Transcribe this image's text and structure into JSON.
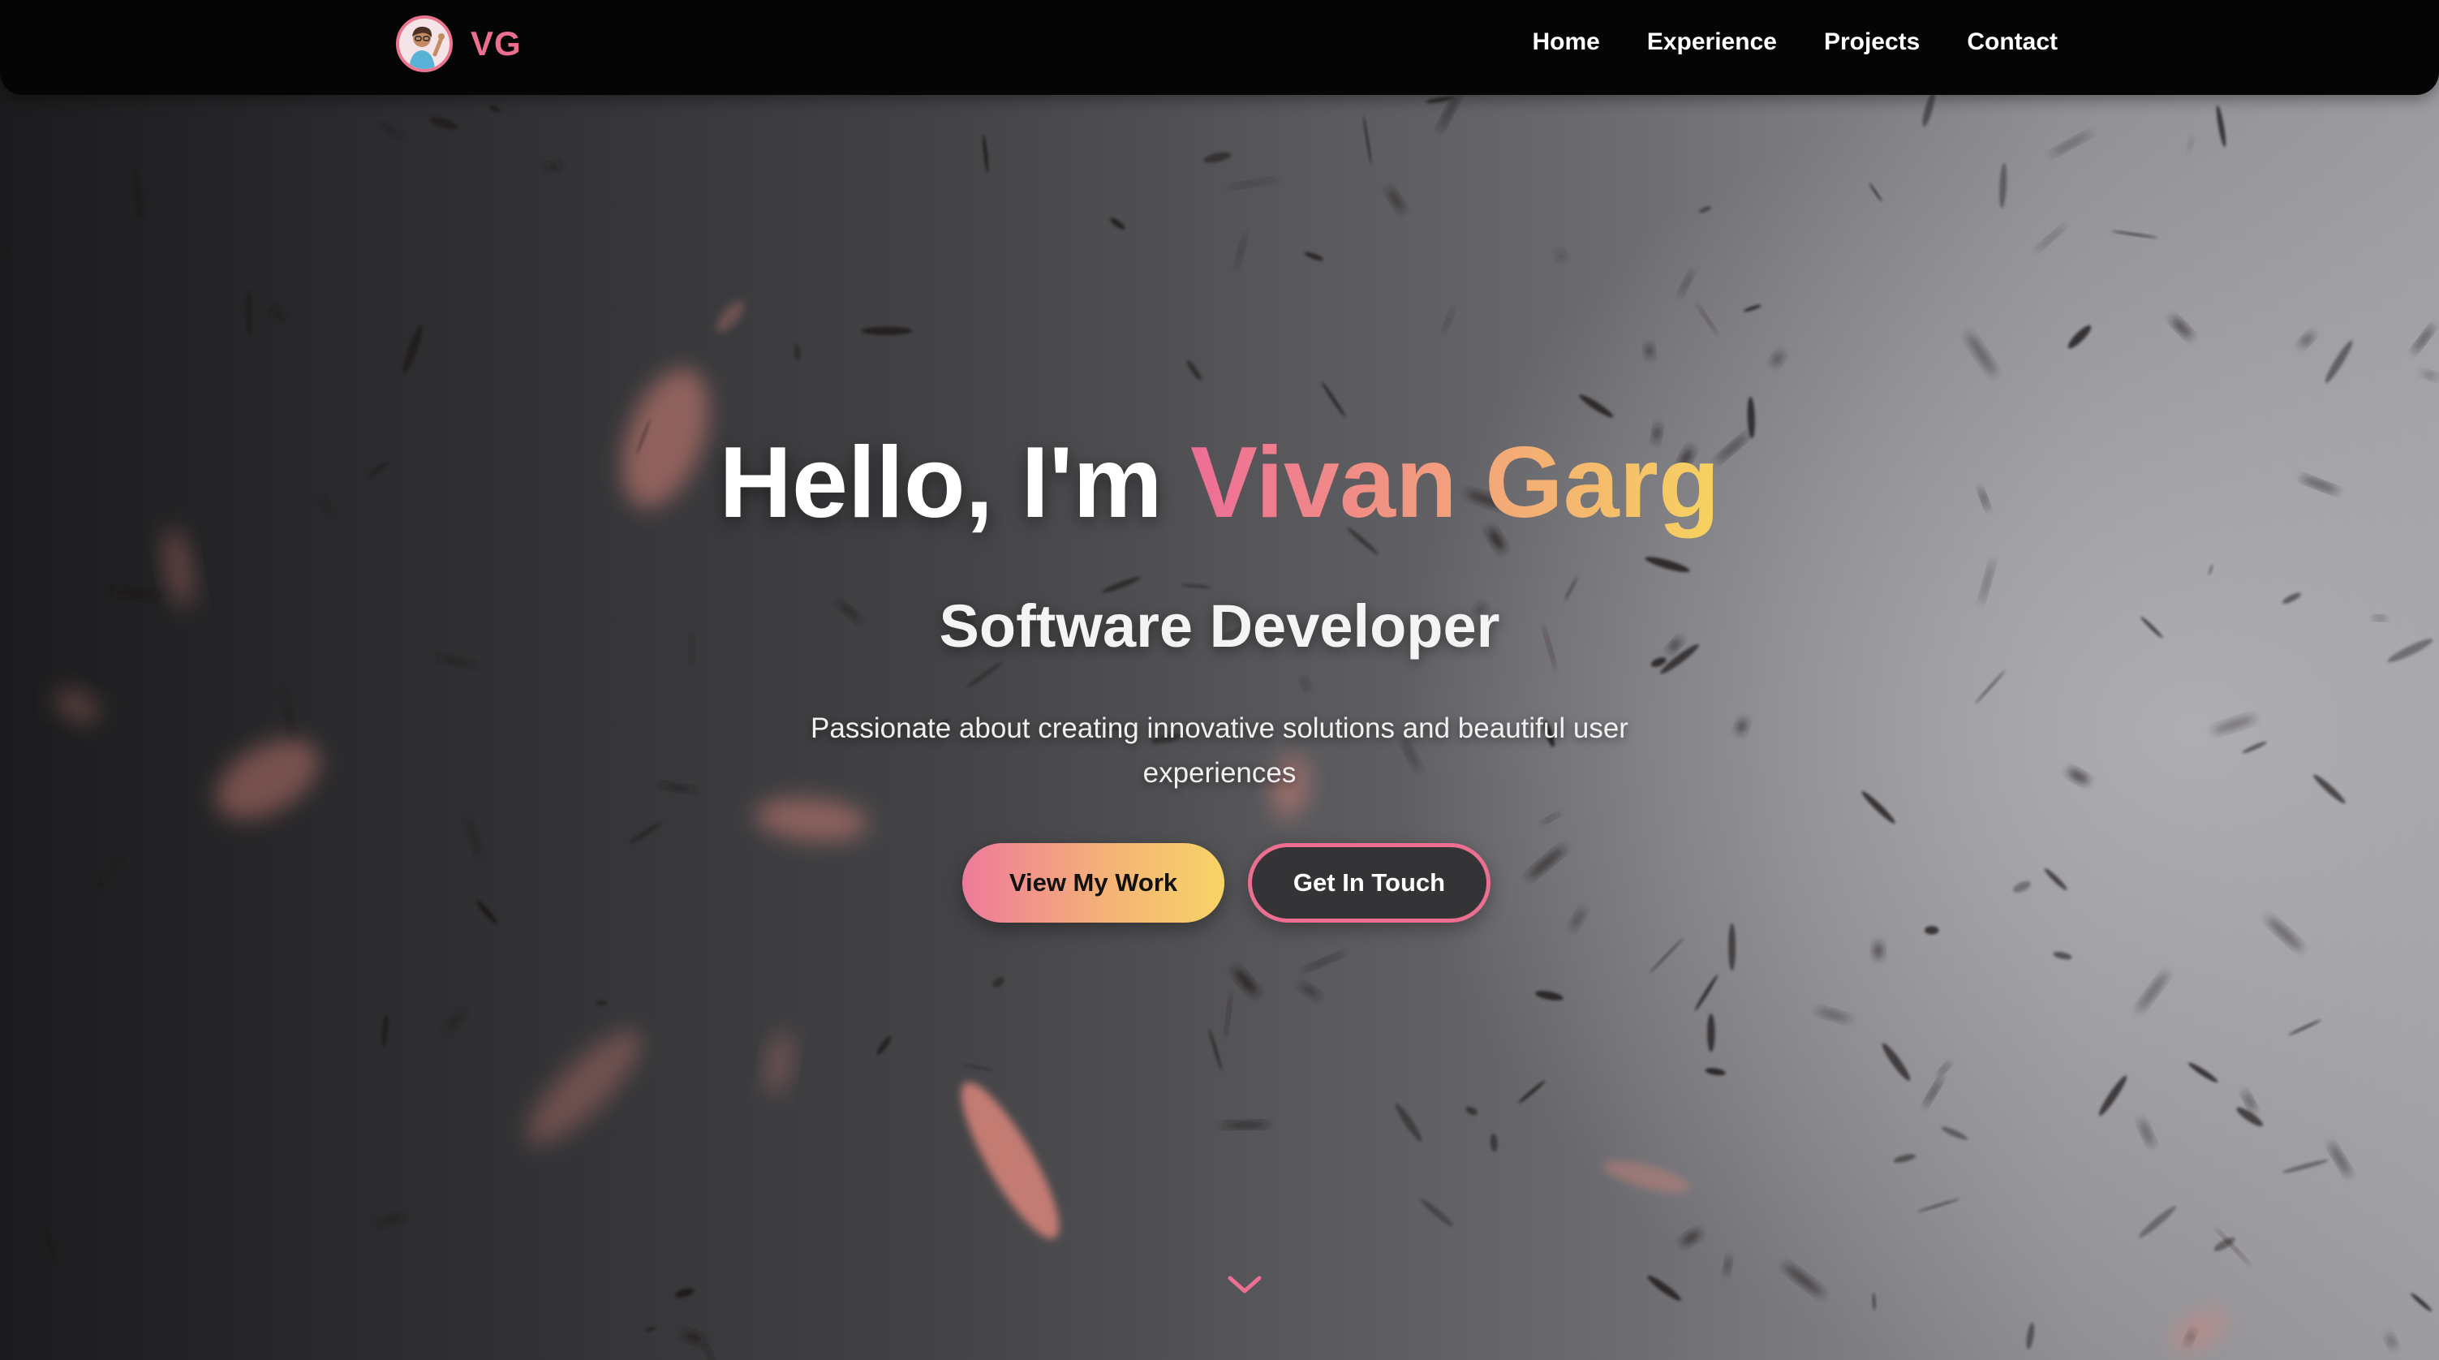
{
  "navbar": {
    "brand_initials": "VG",
    "links": [
      "Home",
      "Experience",
      "Projects",
      "Contact"
    ]
  },
  "hero": {
    "greeting": "Hello, I'm",
    "name": "Vivan Garg",
    "subtitle": "Software Developer",
    "tagline": "Passionate about creating innovative solutions and beautiful user experiences",
    "primary_button": "View My Work",
    "secondary_button": "Get In Touch"
  },
  "icons": {
    "avatar": "avatar-icon",
    "scroll": "chevron-down-icon"
  },
  "colors": {
    "accent_pink": "#ec6f92",
    "accent_orange": "#f2a17c",
    "accent_yellow": "#f7d35f",
    "navbar_bg": "#050505"
  }
}
